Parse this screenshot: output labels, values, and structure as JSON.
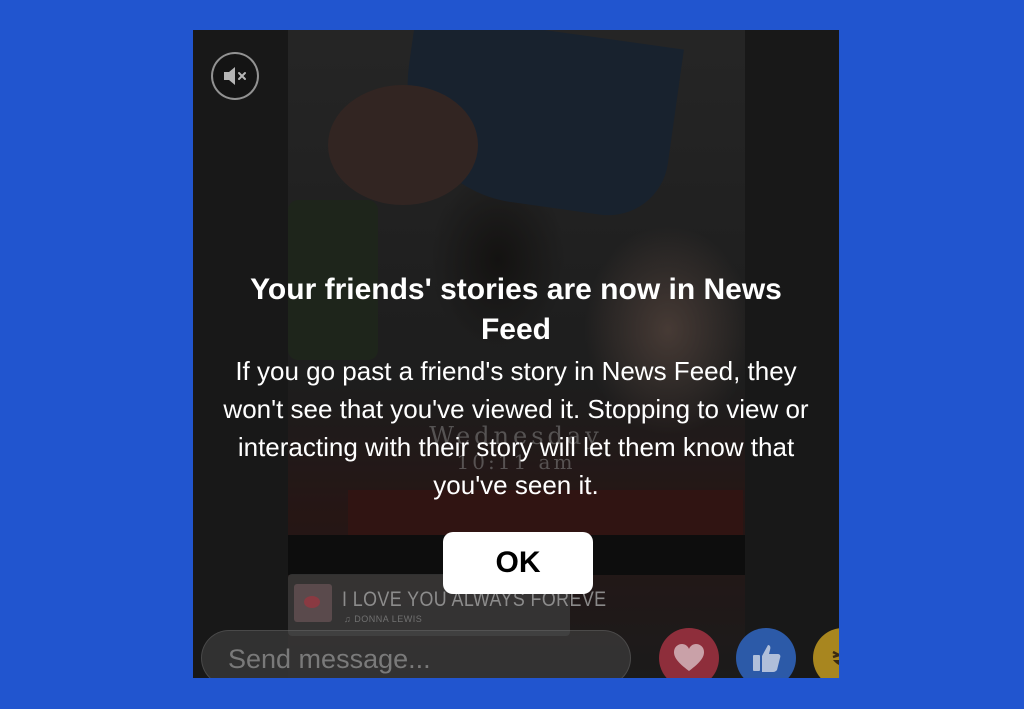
{
  "colors": {
    "background": "#2155cf",
    "card": "#262626",
    "button": "#ffffff",
    "love": "#8e2e3b",
    "like": "#2c5aa8",
    "haha": "#a8861f"
  },
  "story": {
    "date_overlay": "Wednesday",
    "time_overlay": "10:11 am",
    "music": {
      "title": "I LOVE YOU ALWAYS FOREVE",
      "artist": "DONNA LEWIS"
    }
  },
  "controls": {
    "mute_icon": "speaker-muted-icon",
    "message_placeholder": "Send message...",
    "reactions": [
      "heart-icon",
      "thumbs-up-icon",
      "laughing-face-icon"
    ]
  },
  "modal": {
    "title": "Your friends' stories are now in News Feed",
    "body": "If you go past a friend's story in News Feed, they won't see that you've viewed it. Stopping to view or interacting with their story will let them know that you've seen it.",
    "ok_label": "OK"
  }
}
